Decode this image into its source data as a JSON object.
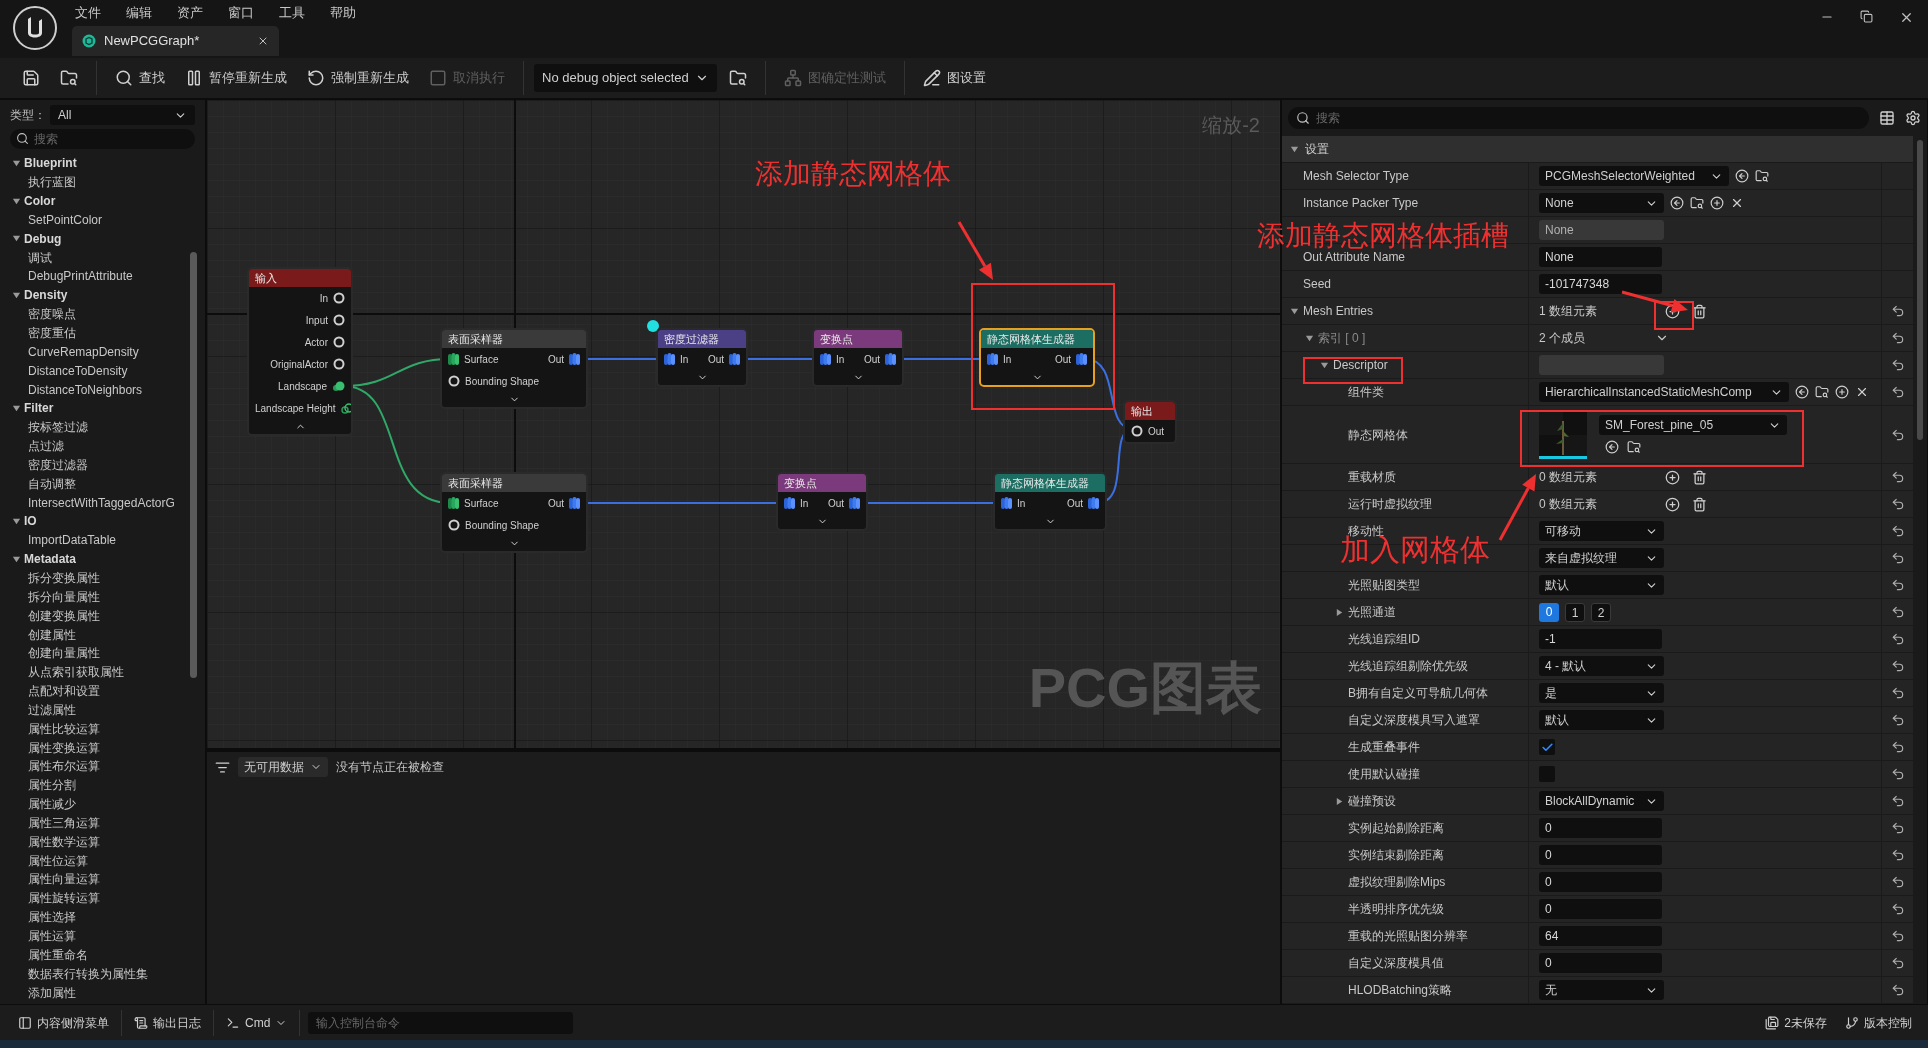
{
  "menu": [
    "文件",
    "编辑",
    "资产",
    "窗口",
    "工具",
    "帮助"
  ],
  "tab": {
    "title": "NewPCGGraph*",
    "selected": true
  },
  "toolbar": [
    {
      "kind": "save",
      "disabled": false
    },
    {
      "kind": "browse",
      "disabled": false
    },
    {
      "kind": "find",
      "label": "查找",
      "disabled": false
    },
    {
      "kind": "pause",
      "label": "暂停重新生成",
      "disabled": false
    },
    {
      "kind": "regenerate",
      "label": "强制重新生成",
      "disabled": false
    },
    {
      "kind": "cancel",
      "label": "取消执行",
      "disabled": true
    },
    {
      "kind": "debug",
      "label": "No debug object selected",
      "disabled": false
    },
    {
      "kind": "browse",
      "disabled": false
    },
    {
      "kind": "determinism",
      "label": "图确定性测试",
      "disabled": true
    },
    {
      "kind": "settings",
      "label": "图设置",
      "disabled": false
    }
  ],
  "palette": {
    "type_label": "类型：",
    "type_value": "All",
    "search_placeholder": "搜索",
    "tree": [
      {
        "label": "Blueprint",
        "expanded": true,
        "children": [
          "执行蓝图"
        ]
      },
      {
        "label": "Color",
        "expanded": true,
        "children": [
          "SetPointColor"
        ]
      },
      {
        "label": "Debug",
        "expanded": true,
        "children": [
          "调试",
          "DebugPrintAttribute"
        ]
      },
      {
        "label": "Density",
        "expanded": true,
        "children": [
          "密度噪点",
          "密度重估",
          "CurveRemapDensity",
          "DistanceToDensity",
          "DistanceToNeighbors"
        ]
      },
      {
        "label": "Filter",
        "expanded": true,
        "children": [
          "按标签过滤",
          "点过滤",
          "密度过滤器",
          "自动调整",
          "IntersectWithTaggedActorG"
        ]
      },
      {
        "label": "IO",
        "expanded": true,
        "children": [
          "ImportDataTable"
        ]
      },
      {
        "label": "Metadata",
        "expanded": true,
        "children": [
          "拆分变换属性",
          "拆分向量属性",
          "创建变换属性",
          "创建属性",
          "创建向量属性",
          "从点索引获取属性",
          "点配对和设置",
          "过滤属性",
          "属性比较运算",
          "属性变换运算",
          "属性布尔运算",
          "属性分割",
          "属性减少",
          "属性三角运算",
          "属性数学运算",
          "属性位运算",
          "属性向量运算",
          "属性旋转运算",
          "属性选择",
          "属性运算",
          "属性重命名",
          "数据表行转换为属性集",
          "添加属性"
        ]
      }
    ]
  },
  "graph": {
    "zoom_label": "缩放-2",
    "watermark": "PCG图表",
    "nodes": [
      {
        "title": "输入",
        "color": "#7a1a1a",
        "selected": false,
        "advanced_expanded": true,
        "rows": [
          {
            "out": {
              "label": "In",
              "kind": "any"
            }
          },
          {
            "out": {
              "label": "Input",
              "kind": "any"
            }
          },
          {
            "out": {
              "label": "Actor",
              "kind": "any"
            }
          },
          {
            "out": {
              "label": "OriginalActor",
              "kind": "any"
            }
          },
          {
            "out": {
              "label": "Landscape",
              "kind": "landscape"
            }
          },
          {
            "out": {
              "label": "Landscape Height",
              "kind": "height"
            }
          }
        ]
      },
      {
        "title": "表面采样器",
        "color": "#3a3a3a",
        "selected": false,
        "advanced_expanded": false,
        "rows": [
          {
            "in": {
              "label": "Surface",
              "kind": "spatial"
            },
            "out": {
              "label": "Out",
              "kind": "point"
            }
          },
          {
            "in": {
              "label": "Bounding Shape",
              "kind": "any"
            }
          }
        ]
      },
      {
        "title": "密度过滤器",
        "color": "#4b3f86",
        "selected": false,
        "advanced_expanded": false,
        "rows": [
          {
            "in": {
              "label": "In",
              "kind": "point"
            },
            "out": {
              "label": "Out",
              "kind": "point"
            }
          }
        ]
      },
      {
        "title": "变换点",
        "color": "#7b3a7b",
        "selected": false,
        "advanced_expanded": false,
        "rows": [
          {
            "in": {
              "label": "In",
              "kind": "point"
            },
            "out": {
              "label": "Out",
              "kind": "point"
            }
          }
        ]
      },
      {
        "title": "静态网格体生成器",
        "color": "#1d6e62",
        "selected": true,
        "advanced_expanded": false,
        "rows": [
          {
            "in": {
              "label": "In",
              "kind": "point"
            },
            "out": {
              "label": "Out",
              "kind": "point"
            }
          }
        ]
      },
      {
        "title": "输出",
        "color": "#7a1a1a",
        "selected": false,
        "rows": [
          {
            "in": {
              "label": "Out",
              "kind": "any"
            }
          }
        ]
      },
      {
        "title": "表面采样器",
        "color": "#3a3a3a",
        "selected": false,
        "advanced_expanded": false,
        "rows": [
          {
            "in": {
              "label": "Surface",
              "kind": "spatial"
            },
            "out": {
              "label": "Out",
              "kind": "point"
            }
          },
          {
            "in": {
              "label": "Bounding Shape",
              "kind": "any"
            }
          }
        ]
      },
      {
        "title": "变换点",
        "color": "#7b3a7b",
        "selected": false,
        "advanced_expanded": false,
        "rows": [
          {
            "in": {
              "label": "In",
              "kind": "point"
            },
            "out": {
              "label": "Out",
              "kind": "point"
            }
          }
        ]
      },
      {
        "title": "静态网格体生成器",
        "color": "#1d6e62",
        "selected": false,
        "advanced_expanded": false,
        "rows": [
          {
            "in": {
              "label": "In",
              "kind": "point"
            },
            "out": {
              "label": "Out",
              "kind": "point"
            }
          }
        ]
      }
    ]
  },
  "inspector": {
    "filter_value": "无可用数据",
    "message": "没有节点正在被检查"
  },
  "details": {
    "search_placeholder": "搜索",
    "rows": [
      {
        "kind": "section",
        "label": "设置",
        "expanded": true,
        "resettable": false,
        "children": [
          {
            "kind": "dropdown",
            "label": "Mesh Selector Type",
            "value": "PCGMeshSelectorWeighted",
            "resettable": false,
            "actions": [
              {
                "kind": "use"
              },
              {
                "kind": "browse"
              }
            ]
          },
          {
            "kind": "dropdown",
            "label": "Instance Packer Type",
            "value": "None",
            "resettable": false,
            "actions": [
              {
                "kind": "use"
              },
              {
                "kind": "browse"
              },
              {
                "kind": "add"
              },
              {
                "kind": "clear"
              }
            ]
          },
          {
            "kind": "readonly",
            "value": "None",
            "resettable": false
          },
          {
            "kind": "text",
            "label": "Out Attribute Name",
            "value": "None",
            "resettable": false
          },
          {
            "kind": "text",
            "label": "Seed",
            "value": "-101747348",
            "resettable": false
          },
          {
            "kind": "array",
            "label": "Mesh Entries",
            "value": "1 数组元素",
            "expanded": true,
            "resettable": true,
            "children": [
              {
                "kind": "struct",
                "label": "索引 [ 0 ]",
                "value": "2 个成员",
                "expanded": true,
                "resettable": true,
                "children": [
                  {
                    "kind": "group",
                    "label": "Descriptor",
                    "expanded": true,
                    "resettable": true,
                    "children": [
                      {
                        "kind": "dropdown",
                        "label": "组件类",
                        "value": "HierarchicalInstancedStaticMeshComp",
                        "resettable": true,
                        "actions": [
                          {
                            "kind": "use"
                          },
                          {
                            "kind": "browse"
                          },
                          {
                            "kind": "add"
                          },
                          {
                            "kind": "clear"
                          }
                        ]
                      },
                      {
                        "kind": "mesh",
                        "label": "静态网格体",
                        "value": "SM_Forest_pine_05",
                        "resettable": true,
                        "actions": [
                          {
                            "kind": "use"
                          },
                          {
                            "kind": "browse"
                          }
                        ]
                      },
                      {
                        "kind": "array",
                        "label": "重载材质",
                        "value": "0 数组元素",
                        "resettable": true
                      },
                      {
                        "kind": "array",
                        "label": "运行时虚拟纹理",
                        "value": "0 数组元素",
                        "resettable": true
                      },
                      {
                        "kind": "dropdown",
                        "label": "移动性",
                        "value": "可移动",
                        "resettable": true
                      },
                      {
                        "kind": "dropdown",
                        "value": "来自虚拟纹理",
                        "resettable": true
                      },
                      {
                        "kind": "dropdown",
                        "label": "光照贴图类型",
                        "value": "默认",
                        "resettable": true
                      },
                      {
                        "kind": "channels",
                        "label": "光照通道",
                        "expanded": false,
                        "resettable": true,
                        "options": [
                          {
                            "label": "0",
                            "selected": true
                          },
                          {
                            "label": "1",
                            "selected": false
                          },
                          {
                            "label": "2",
                            "selected": false
                          }
                        ]
                      },
                      {
                        "kind": "text",
                        "label": "光线追踪组ID",
                        "value": "-1",
                        "resettable": true
                      },
                      {
                        "kind": "dropdown",
                        "label": "光线追踪组剔除优先级",
                        "value": "4 - 默认",
                        "resettable": true
                      },
                      {
                        "kind": "dropdown",
                        "label": "B拥有自定义可导航几何体",
                        "value": "是",
                        "resettable": true
                      },
                      {
                        "kind": "dropdown",
                        "label": "自定义深度模具写入遮罩",
                        "value": "默认",
                        "resettable": true
                      },
                      {
                        "kind": "checkbox",
                        "label": "生成重叠事件",
                        "checked": true,
                        "resettable": true
                      },
                      {
                        "kind": "checkbox",
                        "label": "使用默认碰撞",
                        "checked": false,
                        "resettable": true
                      },
                      {
                        "kind": "dropdown",
                        "label": "碰撞预设",
                        "value": "BlockAllDynamic",
                        "expanded": false,
                        "resettable": true
                      },
                      {
                        "kind": "text",
                        "label": "实例起始剔除距离",
                        "value": "0",
                        "resettable": true
                      },
                      {
                        "kind": "text",
                        "label": "实例结束剔除距离",
                        "value": "0",
                        "resettable": true
                      },
                      {
                        "kind": "text",
                        "label": "虚拟纹理剔除Mips",
                        "value": "0",
                        "resettable": true
                      },
                      {
                        "kind": "text",
                        "label": "半透明排序优先级",
                        "value": "0",
                        "resettable": true
                      },
                      {
                        "kind": "text",
                        "label": "重载的光照贴图分辨率",
                        "value": "64",
                        "resettable": true
                      },
                      {
                        "kind": "text",
                        "label": "自定义深度模具值",
                        "value": "0",
                        "resettable": true
                      },
                      {
                        "kind": "dropdown",
                        "label": "HLODBatching策略",
                        "value": "无",
                        "resettable": true
                      }
                    ]
                  }
                ]
              }
            ]
          }
        ]
      }
    ]
  },
  "status_bar": {
    "left": [
      {
        "kind": "content_drawer",
        "label": "内容侧滑菜单"
      },
      {
        "kind": "output_log",
        "label": "输出日志"
      },
      {
        "kind": "cmd",
        "label": "Cmd"
      }
    ],
    "console_placeholder": "输入控制台命令",
    "right": [
      {
        "kind": "unsaved",
        "label": "2未保存"
      },
      {
        "kind": "source_control",
        "label": "版本控制"
      }
    ]
  },
  "annotations": [
    "添加静态网格体",
    "添加静态网格体插槽",
    "加入网格体"
  ]
}
